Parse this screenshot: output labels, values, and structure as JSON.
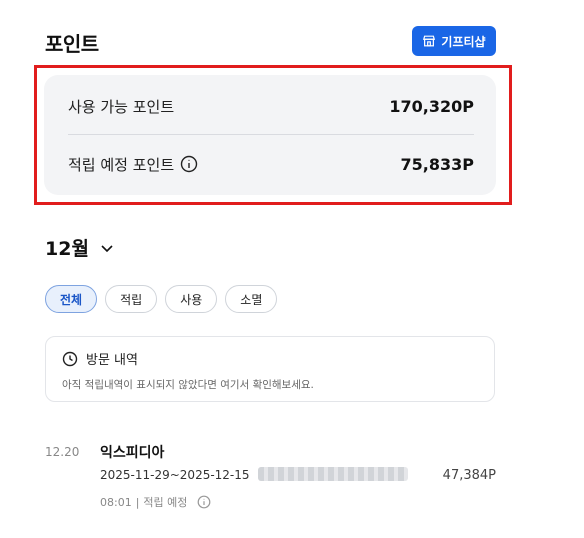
{
  "header": {
    "title": "포인트",
    "gift_button_label": "기프티샵"
  },
  "points": {
    "available_label": "사용 가능 포인트",
    "available_value": "170,320P",
    "expected_label": "적립 예정 포인트",
    "expected_value": "75,833P"
  },
  "month": {
    "label": "12월"
  },
  "filters": [
    "전체",
    "적립",
    "사용",
    "소멸"
  ],
  "active_filter": "전체",
  "visit_card": {
    "title": "방문 내역",
    "description": "아직 적립내역이 표시되지 않았다면 여기서 확인해보세요."
  },
  "transaction": {
    "date": "12.20",
    "name": "익스피디아",
    "period": "2025-11-29~2025-12-15",
    "amount": "47,384P",
    "time": "08:01",
    "separator": "|",
    "status": "적립 예정"
  },
  "colors": {
    "accent": "#1a66e6",
    "highlight_border": "#e11d1d",
    "card_background": "#f3f4f6"
  },
  "icons": {
    "gift_button": "gift-shop-icon",
    "info": "info-icon",
    "month_toggle": "chevron-down-icon",
    "visit_history": "clock-icon"
  }
}
